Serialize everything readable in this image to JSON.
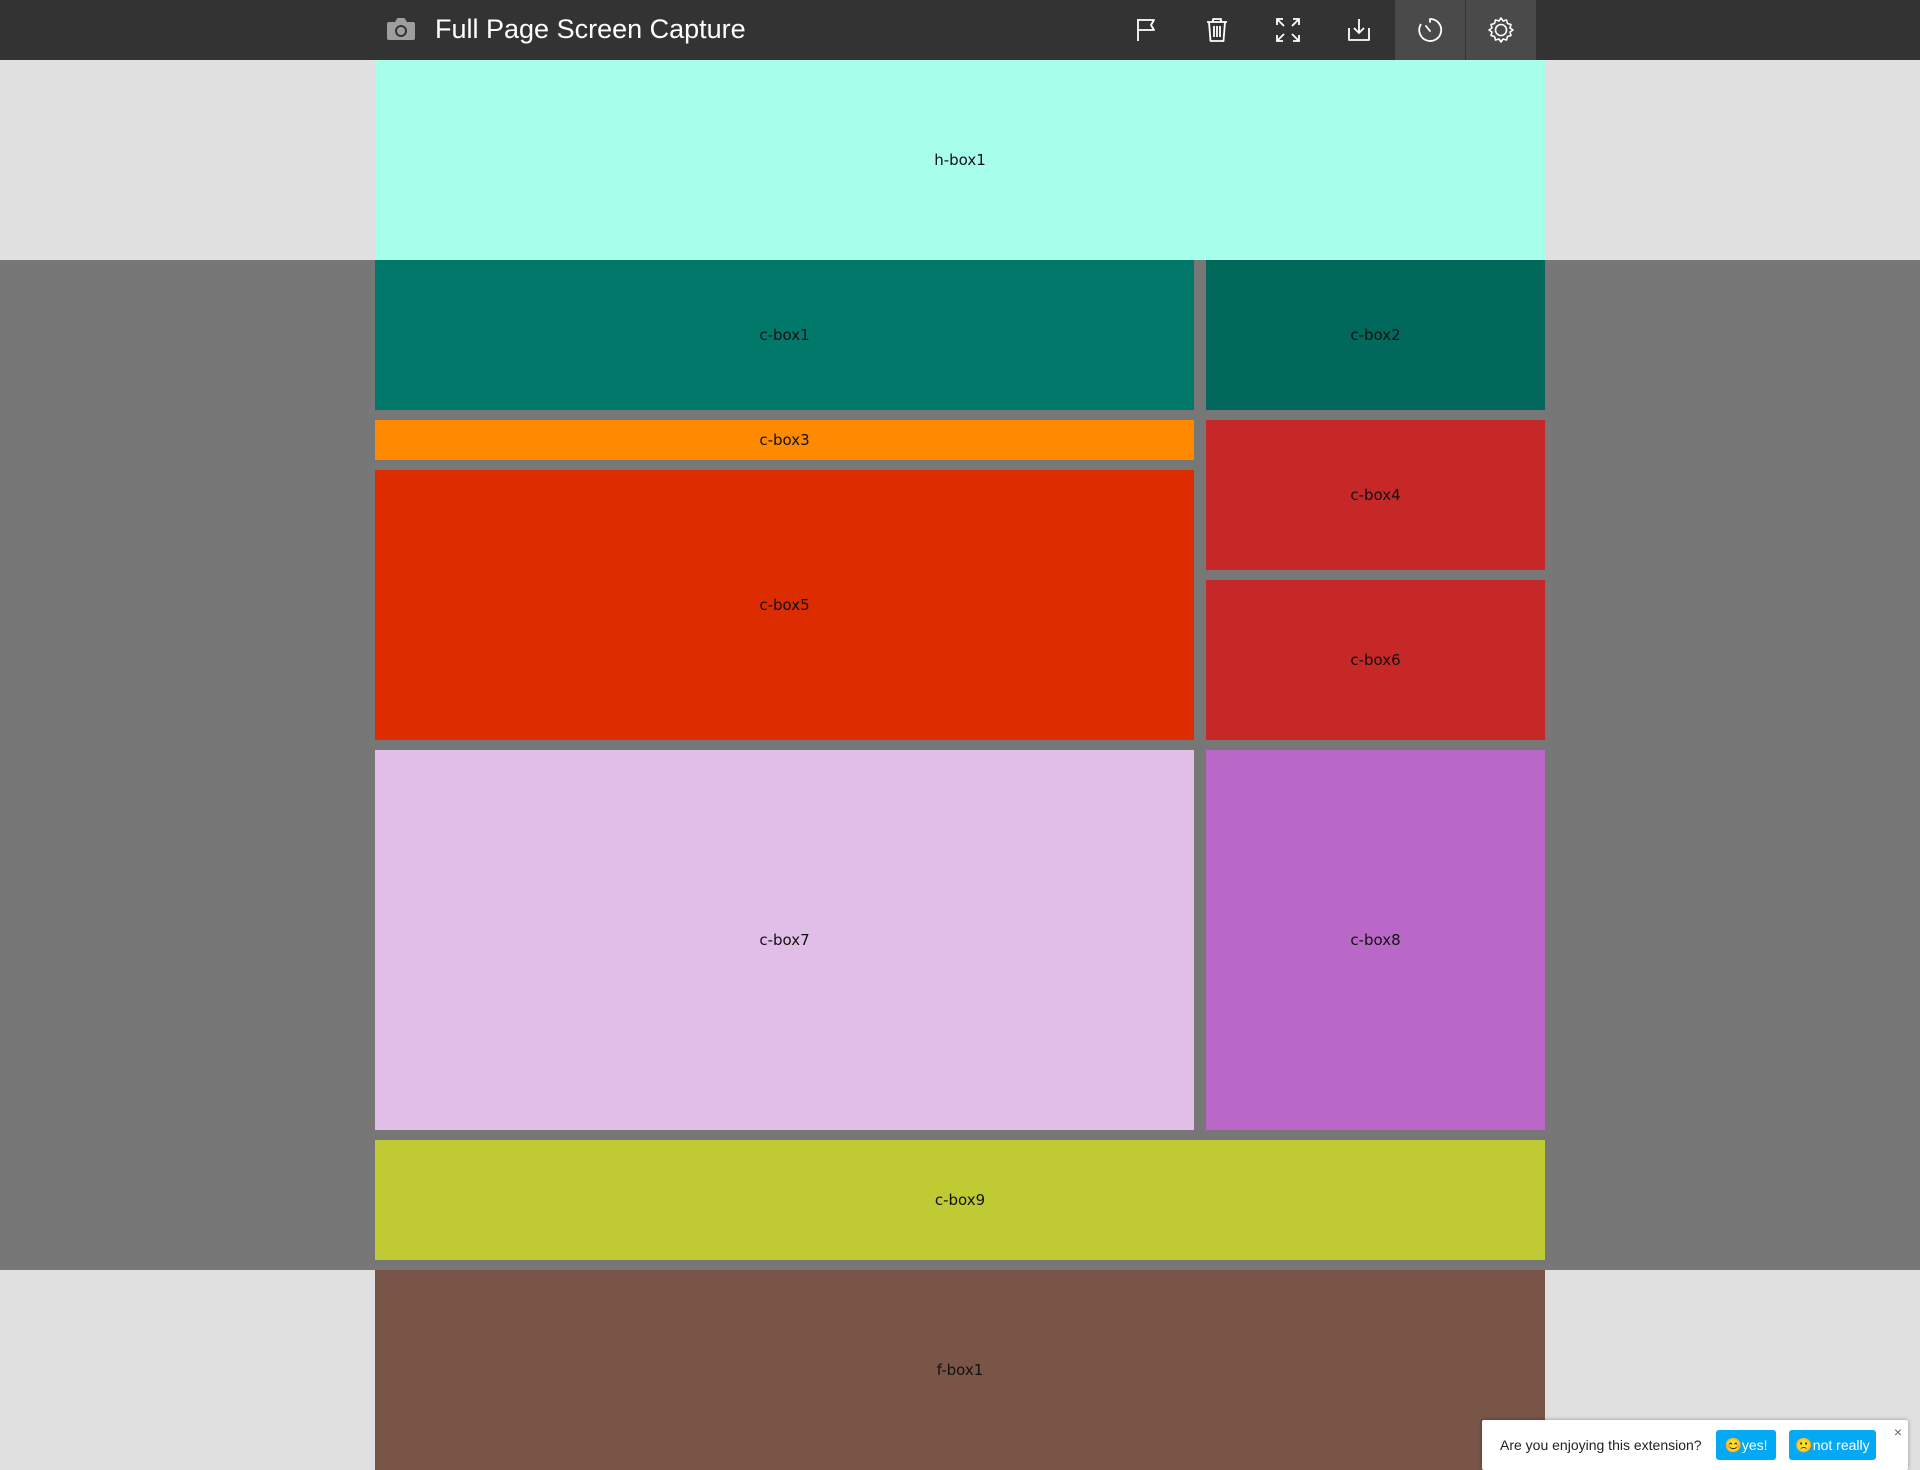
{
  "toolbar": {
    "title": "Full Page Screen Capture",
    "icons": [
      "camera-icon",
      "flag-icon",
      "trash-icon",
      "fullscreen-icon",
      "download-icon",
      "timer-icon",
      "gear-icon"
    ]
  },
  "boxes": {
    "h_box1": "h-box1",
    "c_box1": "c-box1",
    "c_box2": "c-box2",
    "c_box3": "c-box3",
    "c_box4": "c-box4",
    "c_box5": "c-box5",
    "c_box6": "c-box6",
    "c_box7": "c-box7",
    "c_box8": "c-box8",
    "c_box9": "c-box9",
    "f_box1": "f-box1"
  },
  "colors": {
    "topbar": "#333333",
    "page_bg": "#e0e0e0",
    "content_bg": "#777777",
    "h_box1": "#a7ffeb",
    "c_box1": "#00796b",
    "c_box2": "#00695c",
    "c_box3": "#ff8a00",
    "c_box4": "#c62828",
    "c_box5": "#dd2c00",
    "c_box6": "#c62828",
    "c_box7": "#e1bee7",
    "c_box8": "#ba68c8",
    "c_box9": "#c0ca33",
    "f_box1": "#795548",
    "popup_button": "#03a9f4"
  },
  "feedback": {
    "question": "Are you enjoying this extension?",
    "yes_label": "😊yes!",
    "no_label": "🙁not really",
    "close_label": "×"
  }
}
